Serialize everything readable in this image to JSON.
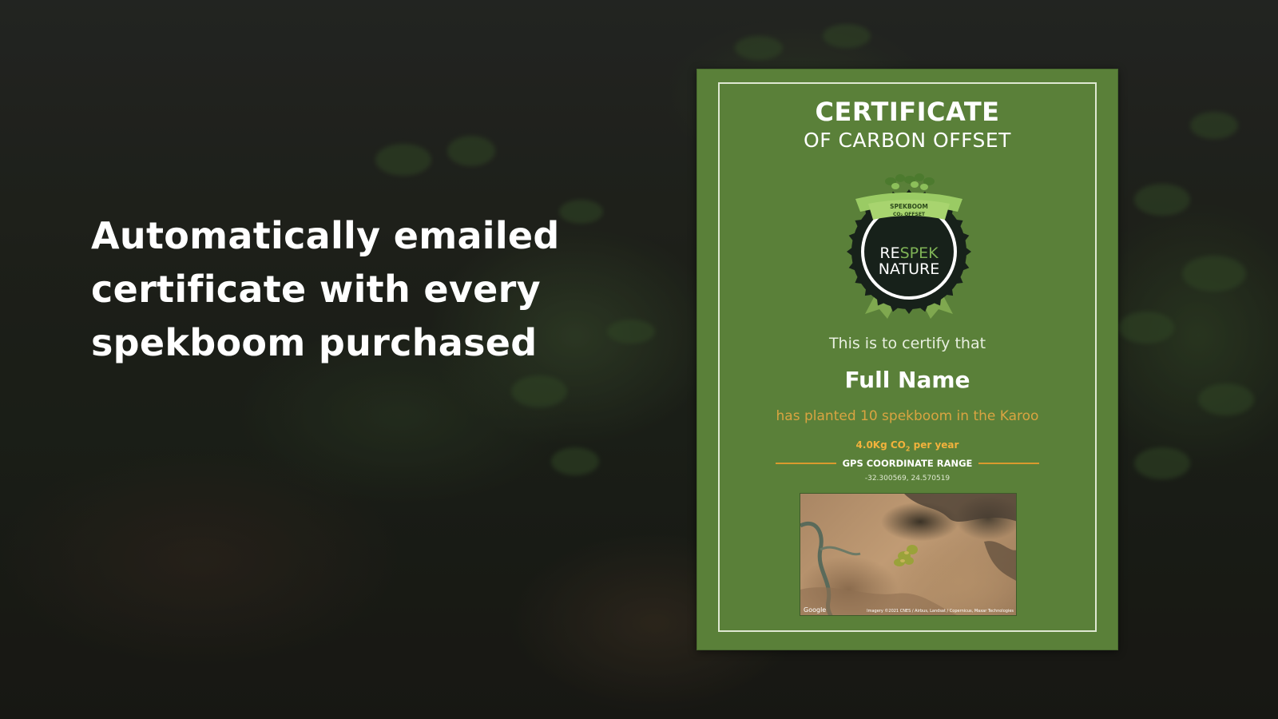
{
  "headline": {
    "line1": "Automatically emailed",
    "line2": "certificate with every",
    "line3": "spekboom purchased"
  },
  "certificate": {
    "title": "CERTIFICATE",
    "subtitle": "OF CARBON OFFSET",
    "badge": {
      "ribbon_line1": "SPEKBOOM",
      "ribbon_line2": "CO₂ OFFSET",
      "logo_re": "RE",
      "logo_spek": "SPEK",
      "logo_nature": "NATURE"
    },
    "certify_text": "This is to certify that",
    "recipient_name": "Full Name",
    "planted_text": "has planted 10 spekboom in the Karoo",
    "co2_prefix": "4.0Kg CO",
    "co2_sub": "2",
    "co2_suffix": " per year",
    "gps_label": "GPS COORDINATE RANGE",
    "coordinates": "-32.300569, 24.570519",
    "map_google": "Google",
    "map_credit": "Imagery ©2021 CNES / Airbus, Landsat / Copernicus, Maxar Technologies"
  },
  "colors": {
    "certificate_green": "#5a8039",
    "accent_gold": "#d9a441",
    "badge_dark": "#17211a"
  }
}
